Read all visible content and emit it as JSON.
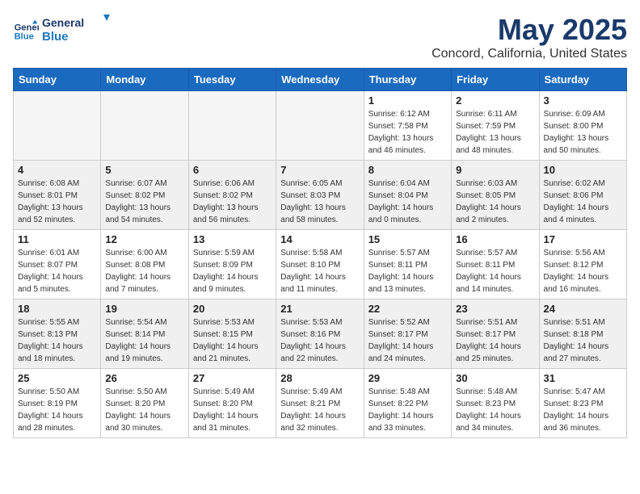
{
  "header": {
    "logo_line1": "General",
    "logo_line2": "Blue",
    "title": "May 2025",
    "subtitle": "Concord, California, United States"
  },
  "weekdays": [
    "Sunday",
    "Monday",
    "Tuesday",
    "Wednesday",
    "Thursday",
    "Friday",
    "Saturday"
  ],
  "weeks": [
    [
      {
        "day": "",
        "info": ""
      },
      {
        "day": "",
        "info": ""
      },
      {
        "day": "",
        "info": ""
      },
      {
        "day": "",
        "info": ""
      },
      {
        "day": "1",
        "info": "Sunrise: 6:12 AM\nSunset: 7:58 PM\nDaylight: 13 hours\nand 46 minutes."
      },
      {
        "day": "2",
        "info": "Sunrise: 6:11 AM\nSunset: 7:59 PM\nDaylight: 13 hours\nand 48 minutes."
      },
      {
        "day": "3",
        "info": "Sunrise: 6:09 AM\nSunset: 8:00 PM\nDaylight: 13 hours\nand 50 minutes."
      }
    ],
    [
      {
        "day": "4",
        "info": "Sunrise: 6:08 AM\nSunset: 8:01 PM\nDaylight: 13 hours\nand 52 minutes."
      },
      {
        "day": "5",
        "info": "Sunrise: 6:07 AM\nSunset: 8:02 PM\nDaylight: 13 hours\nand 54 minutes."
      },
      {
        "day": "6",
        "info": "Sunrise: 6:06 AM\nSunset: 8:02 PM\nDaylight: 13 hours\nand 56 minutes."
      },
      {
        "day": "7",
        "info": "Sunrise: 6:05 AM\nSunset: 8:03 PM\nDaylight: 13 hours\nand 58 minutes."
      },
      {
        "day": "8",
        "info": "Sunrise: 6:04 AM\nSunset: 8:04 PM\nDaylight: 14 hours\nand 0 minutes."
      },
      {
        "day": "9",
        "info": "Sunrise: 6:03 AM\nSunset: 8:05 PM\nDaylight: 14 hours\nand 2 minutes."
      },
      {
        "day": "10",
        "info": "Sunrise: 6:02 AM\nSunset: 8:06 PM\nDaylight: 14 hours\nand 4 minutes."
      }
    ],
    [
      {
        "day": "11",
        "info": "Sunrise: 6:01 AM\nSunset: 8:07 PM\nDaylight: 14 hours\nand 5 minutes."
      },
      {
        "day": "12",
        "info": "Sunrise: 6:00 AM\nSunset: 8:08 PM\nDaylight: 14 hours\nand 7 minutes."
      },
      {
        "day": "13",
        "info": "Sunrise: 5:59 AM\nSunset: 8:09 PM\nDaylight: 14 hours\nand 9 minutes."
      },
      {
        "day": "14",
        "info": "Sunrise: 5:58 AM\nSunset: 8:10 PM\nDaylight: 14 hours\nand 11 minutes."
      },
      {
        "day": "15",
        "info": "Sunrise: 5:57 AM\nSunset: 8:11 PM\nDaylight: 14 hours\nand 13 minutes."
      },
      {
        "day": "16",
        "info": "Sunrise: 5:57 AM\nSunset: 8:11 PM\nDaylight: 14 hours\nand 14 minutes."
      },
      {
        "day": "17",
        "info": "Sunrise: 5:56 AM\nSunset: 8:12 PM\nDaylight: 14 hours\nand 16 minutes."
      }
    ],
    [
      {
        "day": "18",
        "info": "Sunrise: 5:55 AM\nSunset: 8:13 PM\nDaylight: 14 hours\nand 18 minutes."
      },
      {
        "day": "19",
        "info": "Sunrise: 5:54 AM\nSunset: 8:14 PM\nDaylight: 14 hours\nand 19 minutes."
      },
      {
        "day": "20",
        "info": "Sunrise: 5:53 AM\nSunset: 8:15 PM\nDaylight: 14 hours\nand 21 minutes."
      },
      {
        "day": "21",
        "info": "Sunrise: 5:53 AM\nSunset: 8:16 PM\nDaylight: 14 hours\nand 22 minutes."
      },
      {
        "day": "22",
        "info": "Sunrise: 5:52 AM\nSunset: 8:17 PM\nDaylight: 14 hours\nand 24 minutes."
      },
      {
        "day": "23",
        "info": "Sunrise: 5:51 AM\nSunset: 8:17 PM\nDaylight: 14 hours\nand 25 minutes."
      },
      {
        "day": "24",
        "info": "Sunrise: 5:51 AM\nSunset: 8:18 PM\nDaylight: 14 hours\nand 27 minutes."
      }
    ],
    [
      {
        "day": "25",
        "info": "Sunrise: 5:50 AM\nSunset: 8:19 PM\nDaylight: 14 hours\nand 28 minutes."
      },
      {
        "day": "26",
        "info": "Sunrise: 5:50 AM\nSunset: 8:20 PM\nDaylight: 14 hours\nand 30 minutes."
      },
      {
        "day": "27",
        "info": "Sunrise: 5:49 AM\nSunset: 8:20 PM\nDaylight: 14 hours\nand 31 minutes."
      },
      {
        "day": "28",
        "info": "Sunrise: 5:49 AM\nSunset: 8:21 PM\nDaylight: 14 hours\nand 32 minutes."
      },
      {
        "day": "29",
        "info": "Sunrise: 5:48 AM\nSunset: 8:22 PM\nDaylight: 14 hours\nand 33 minutes."
      },
      {
        "day": "30",
        "info": "Sunrise: 5:48 AM\nSunset: 8:23 PM\nDaylight: 14 hours\nand 34 minutes."
      },
      {
        "day": "31",
        "info": "Sunrise: 5:47 AM\nSunset: 8:23 PM\nDaylight: 14 hours\nand 36 minutes."
      }
    ]
  ]
}
